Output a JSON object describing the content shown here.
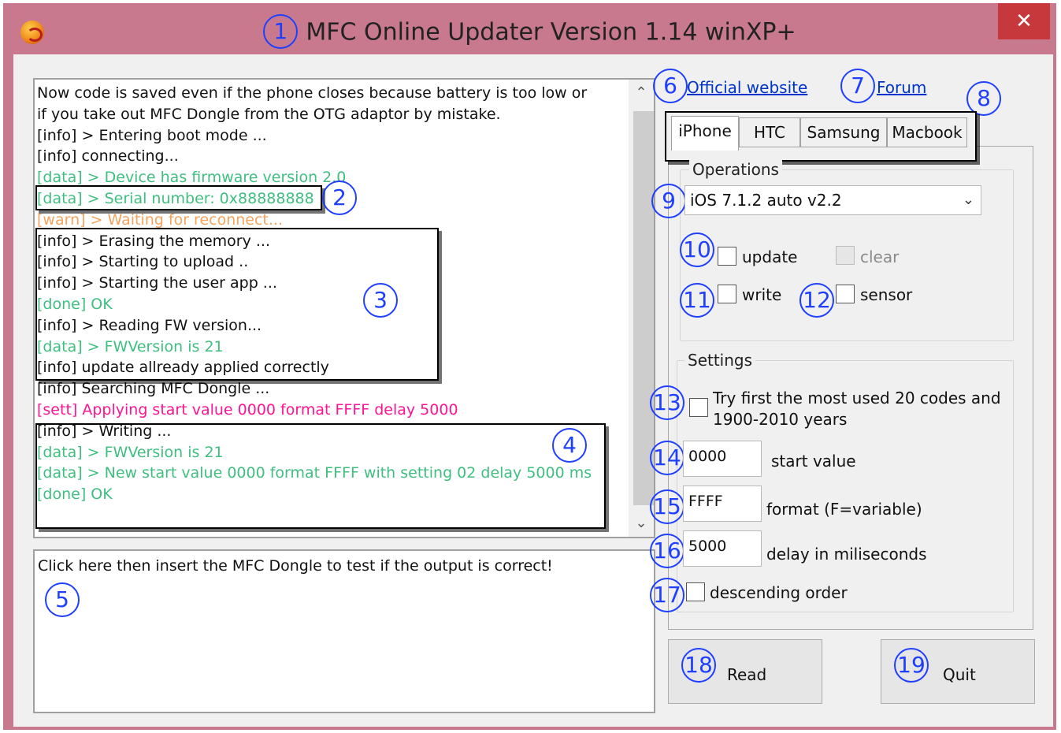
{
  "window": {
    "title": "MFC Online Updater Version 1.14 winXP+",
    "close_symbol": "✕",
    "app_icon": "app-icon"
  },
  "callouts": [
    "1",
    "2",
    "3",
    "4",
    "5",
    "6",
    "7",
    "8",
    "9",
    "10",
    "11",
    "12",
    "13",
    "14",
    "15",
    "16",
    "17",
    "18",
    "19"
  ],
  "log": {
    "lines": [
      {
        "text": "Now code is saved even if the phone closes because battery is too low or",
        "kind": "info"
      },
      {
        "text": "if you take out MFC Dongle from the OTG adaptor by mistake.",
        "kind": "info"
      },
      {
        "text": "[info] > Entering boot mode ...",
        "kind": "info"
      },
      {
        "text": "[info] connecting...",
        "kind": "info"
      },
      {
        "text": "[data] > Device has firmware version 2.0",
        "kind": "data"
      },
      {
        "text": "[data] > Serial number: 0x88888888",
        "kind": "data"
      },
      {
        "text": "[warn] > Waiting for reconnect...",
        "kind": "warn"
      },
      {
        "text": "[info] > Erasing the memory ...",
        "kind": "info"
      },
      {
        "text": "[info] > Starting to upload ..",
        "kind": "info"
      },
      {
        "text": "[info] > Starting the user app ...",
        "kind": "info"
      },
      {
        "text": "[done] OK",
        "kind": "done"
      },
      {
        "text": "[info] > Reading FW version...",
        "kind": "info"
      },
      {
        "text": "[data] > FWVersion is 21",
        "kind": "data"
      },
      {
        "text": "[info] update allready applied correctly",
        "kind": "info"
      },
      {
        "text": "[info] Searching MFC Dongle ...",
        "kind": "info"
      },
      {
        "text": "[sett] Applying start value 0000 format FFFF delay 5000",
        "kind": "sett"
      },
      {
        "text": "[info] > Writing ...",
        "kind": "info"
      },
      {
        "text": "[data] > FWVersion is 21",
        "kind": "data"
      },
      {
        "text": "[data] > New start value 0000 format FFFF with setting 02 delay 5000 ms",
        "kind": "data"
      },
      {
        "text": "[done] OK",
        "kind": "done"
      }
    ],
    "colors": {
      "info": "#111111",
      "data": "#3fbf7f",
      "warn": "#f4a460",
      "done": "#3fbf7f",
      "sett": "#ff1493"
    },
    "scroll_up": "⌃",
    "scroll_down": "⌄"
  },
  "output_box": {
    "text": "Click here then insert the MFC Dongle to test if the output is correct!"
  },
  "links": {
    "official": "Official website",
    "forum": "Forum"
  },
  "tabs": [
    "iPhone",
    "HTC",
    "Samsung",
    "Macbook"
  ],
  "operations": {
    "group_label": "Operations",
    "selected": "iOS 7.1.2 auto v2.2",
    "caret": "⌄",
    "update": "update",
    "clear": "clear",
    "write": "write",
    "sensor": "sensor"
  },
  "settings": {
    "group_label": "Settings",
    "try_first_line1": "Try first the most used 20 codes and",
    "try_first_line2": "1900-2010 years",
    "start_value": "0000",
    "start_label": "start value",
    "format": "FFFF",
    "format_label": "format (F=variable)",
    "delay": "5000",
    "delay_label": "delay in miliseconds",
    "descending": "descending order"
  },
  "buttons": {
    "read": "Read",
    "quit": "Quit"
  }
}
